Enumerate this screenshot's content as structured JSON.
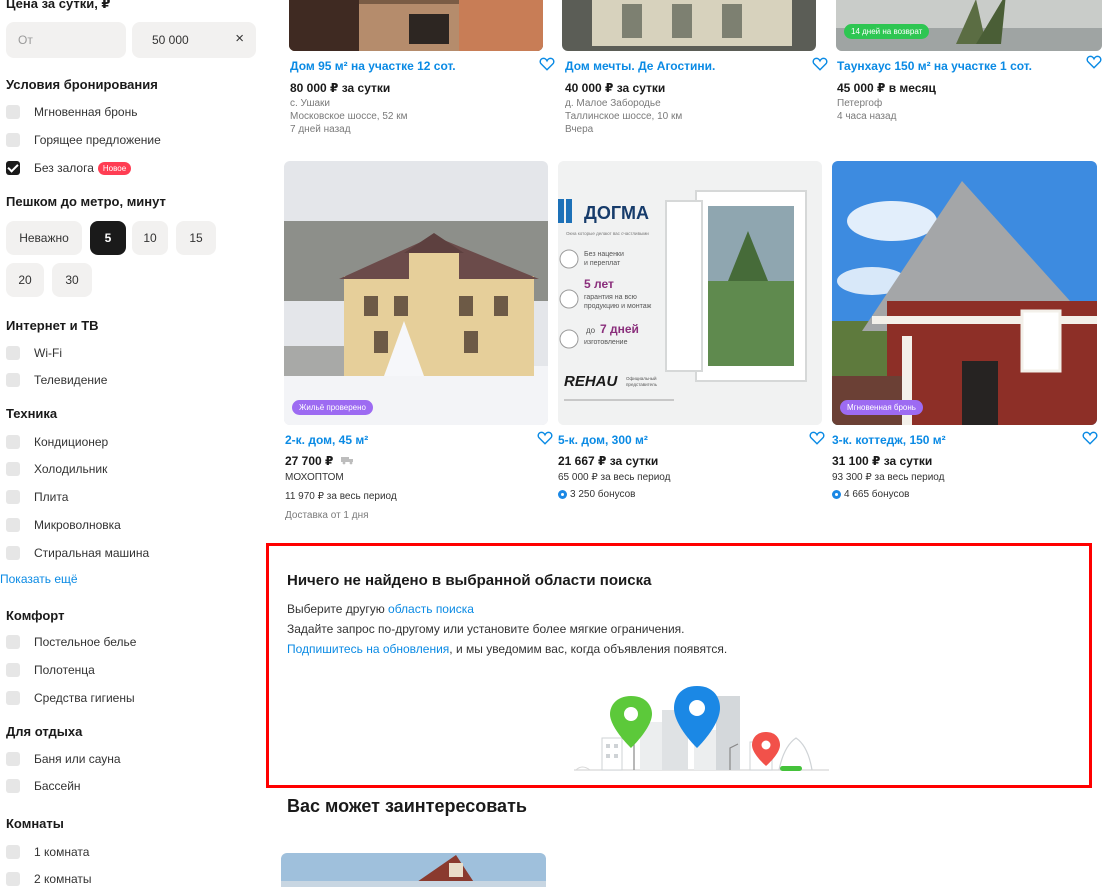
{
  "filters": {
    "price": {
      "title": "Цена за сутки, ₽",
      "from_placeholder": "От",
      "to_value": "50 000",
      "clear_icon": "×"
    },
    "booking": {
      "title": "Условия бронирования",
      "items": [
        {
          "label": "Мгновенная бронь",
          "checked": false
        },
        {
          "label": "Горящее предложение",
          "checked": false
        },
        {
          "label": "Без залога",
          "checked": true,
          "badge": "Новое"
        }
      ]
    },
    "metro": {
      "title": "Пешком до метро, минут",
      "options": [
        "Неважно",
        "5",
        "10",
        "15",
        "20",
        "30"
      ],
      "selected": "5"
    },
    "internet": {
      "title": "Интернет и ТВ",
      "items": [
        "Wi-Fi",
        "Телевидение"
      ]
    },
    "appliances": {
      "title": "Техника",
      "items": [
        "Кондиционер",
        "Холодильник",
        "Плита",
        "Микроволновка",
        "Стиральная машина"
      ],
      "show_more": "Показать ещё"
    },
    "comfort": {
      "title": "Комфорт",
      "items": [
        "Постельное белье",
        "Полотенца",
        "Средства гигиены"
      ]
    },
    "leisure": {
      "title": "Для отдыха",
      "items": [
        "Баня или сауна",
        "Бассейн"
      ]
    },
    "rooms": {
      "title": "Комнаты",
      "items": [
        "1 комната",
        "2 комнаты"
      ]
    }
  },
  "listings_top": [
    {
      "title": "Дом 95 м² на участке 12 сот.",
      "price": "80 000 ₽ за сутки",
      "meta": [
        "с. Ушаки",
        "Московское шоссе, 52 км",
        "7 дней назад"
      ]
    },
    {
      "title": "Дом мечты. Де Агостини.",
      "price": "40 000 ₽ за сутки",
      "meta": [
        "д. Малое Забородье",
        "Таллинское шоссе, 10 км",
        "Вчера"
      ]
    },
    {
      "title": "Таунхаус 150 м² на участке 1 сот.",
      "price": "45 000 ₽ в месяц",
      "meta": [
        "Петергоф",
        "4 часа назад"
      ],
      "tag": "14 дней на возврат"
    }
  ],
  "listings_mid": [
    {
      "title": "2-к. дом, 45 м²",
      "price": "27 700 ₽",
      "seller": "МОХОПТОМ",
      "period": "11 970 ₽ за весь период",
      "delivery": "Доставка от 1 дня",
      "tag": "Жильё проверено"
    },
    {
      "title": "5-к. дом, 300 м²",
      "price": "21 667 ₽ за сутки",
      "period": "65 000 ₽ за весь период",
      "bonus": "3 250 бонусов",
      "ad": {
        "brand": "ДОГМА",
        "subtitle": "Окна которые делают вас счастливыми",
        "f1": "Без наценки",
        "f1b": "и переплат",
        "f2": "5 лет",
        "f2b": "гарантия на всю",
        "f2c": "продукцию и монтаж",
        "f3a": "до",
        "f3": "7 дней",
        "f3b": "изготовление",
        "rehau": "REHAU",
        "rehau_sub1": "Официальный",
        "rehau_sub2": "представитель"
      }
    },
    {
      "title": "3-к. коттедж, 150 м²",
      "price": "31 100 ₽ за сутки",
      "period": "93 300 ₽ за весь период",
      "bonus": "4 665 бонусов",
      "tag": "Мгновенная бронь"
    }
  ],
  "empty_state": {
    "title": "Ничего не найдено в выбранной области поиска",
    "line1_prefix": "Выберите другую ",
    "line1_link": "область поиска",
    "line2": "Задайте запрос по-другому или установите более мягкие ограничения.",
    "line3_link": "Подпишитесь на обновления",
    "line3_suffix": ", и мы уведомим вас, когда объявления появятся."
  },
  "recommendations": {
    "title": "Вас может заинтересовать"
  },
  "colors": {
    "link": "#0a8ae4",
    "highlight_border": "#ff0000",
    "badge_red": "#ff3d53",
    "tag_purple": "#9d6bf2",
    "tag_green": "#2ec652"
  }
}
